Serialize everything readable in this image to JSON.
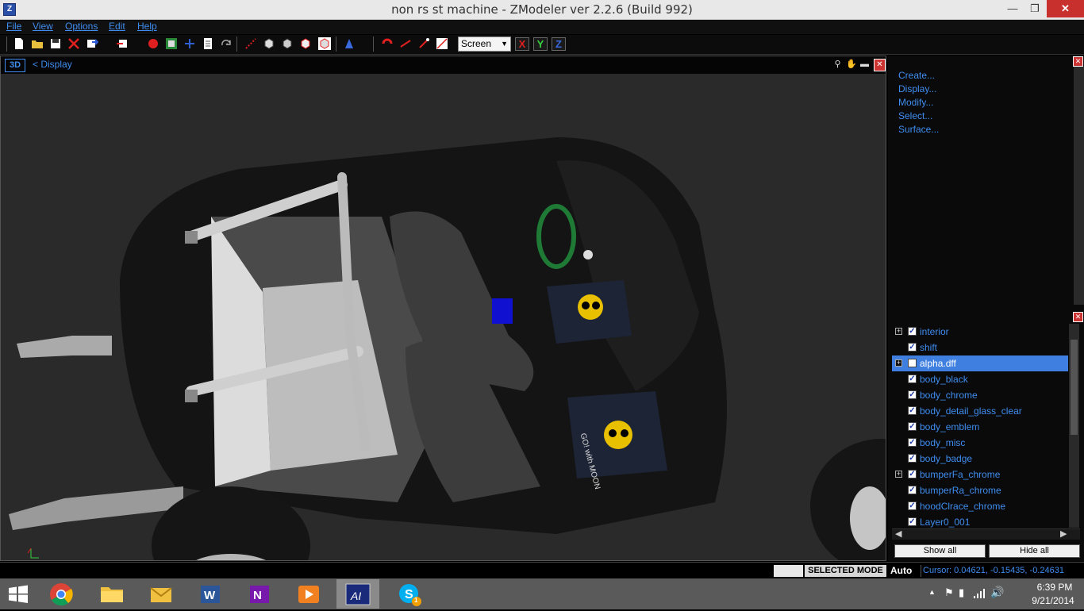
{
  "window": {
    "title": "non rs st machine - ZModeler ver 2.2.6 (Build 992)"
  },
  "menu": [
    "File",
    "View",
    "Options",
    "Edit",
    "Help"
  ],
  "toolbar": {
    "view_mode": "Screen",
    "axis_buttons": [
      "X",
      "Y",
      "Z"
    ]
  },
  "viewport": {
    "mode_label": "3D",
    "breadcrumb": "<  Display"
  },
  "commands": [
    "Create...",
    "Display...",
    "Modify...",
    "Select...",
    "Surface..."
  ],
  "layers": [
    {
      "name": "interior",
      "expandable": true,
      "checked": true,
      "selected": false
    },
    {
      "name": "shift",
      "expandable": false,
      "checked": true,
      "selected": false
    },
    {
      "name": "alpha.dff",
      "expandable": true,
      "checked": false,
      "selected": true
    },
    {
      "name": "body_black",
      "expandable": false,
      "checked": true,
      "selected": false
    },
    {
      "name": "body_chrome",
      "expandable": false,
      "checked": true,
      "selected": false
    },
    {
      "name": "body_detail_glass_clear",
      "expandable": false,
      "checked": true,
      "selected": false
    },
    {
      "name": "body_emblem",
      "expandable": false,
      "checked": true,
      "selected": false
    },
    {
      "name": "body_misc",
      "expandable": false,
      "checked": true,
      "selected": false
    },
    {
      "name": "body_badge",
      "expandable": false,
      "checked": true,
      "selected": false
    },
    {
      "name": "bumperFa_chrome",
      "expandable": true,
      "checked": true,
      "selected": false
    },
    {
      "name": "bumperRa_chrome",
      "expandable": false,
      "checked": true,
      "selected": false
    },
    {
      "name": "hoodClrace_chrome",
      "expandable": false,
      "checked": true,
      "selected": false
    },
    {
      "name": "Layer0_001",
      "expandable": false,
      "checked": true,
      "selected": false
    }
  ],
  "layer_buttons": {
    "show_all": "Show all",
    "hide_all": "Hide all"
  },
  "status": {
    "mode": "SELECTED MODE",
    "auto": "Auto",
    "cursor": "Cursor: 0.04621, -0.15435, -0.24631"
  },
  "scene": {
    "plate_text": "GO! with MOON"
  },
  "taskbar": {
    "apps": [
      "start-icon",
      "chrome-icon",
      "file-explorer-icon",
      "outlook-icon",
      "word-icon",
      "onenote-icon",
      "media-player-icon",
      "asus-ai-icon",
      "skype-icon"
    ],
    "skype_badge": "1",
    "clock": {
      "time": "6:39 PM",
      "date": "9/21/2014"
    }
  },
  "colors": {
    "accent": "#3f8df0",
    "selection": "#3e7fe0",
    "close": "#c7302c"
  }
}
